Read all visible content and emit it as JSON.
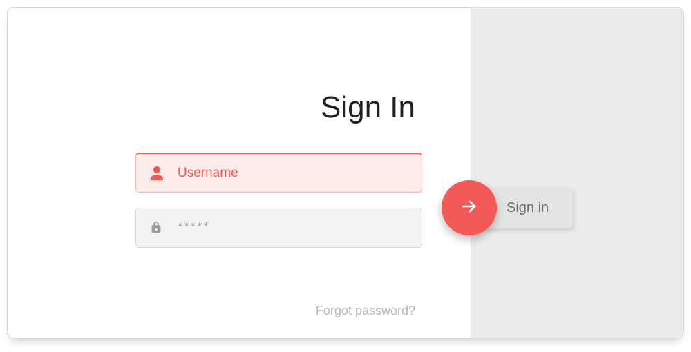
{
  "title": "Sign In",
  "fields": {
    "username": {
      "placeholder": "Username",
      "value": ""
    },
    "password": {
      "placeholder": "*****",
      "value": ""
    }
  },
  "signin_button_label": "Sign in",
  "forgot_link": "Forgot password?",
  "colors": {
    "accent": "#f15a56",
    "accent_light": "#fdebea",
    "panel_gray": "#ececec"
  },
  "icons": {
    "user": "user-icon",
    "lock": "lock-icon",
    "arrow": "arrow-right-icon"
  }
}
